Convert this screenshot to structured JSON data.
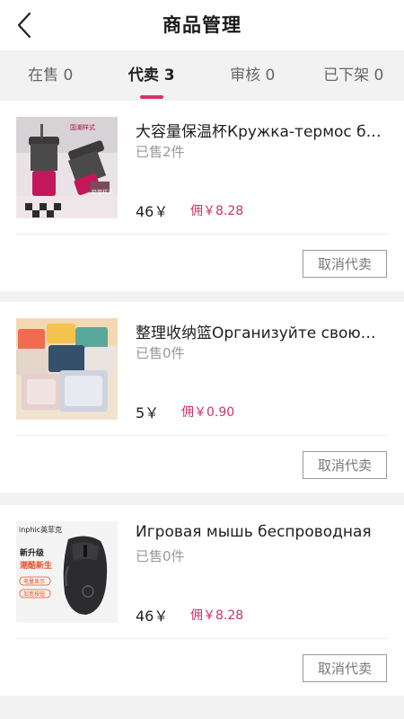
{
  "header": {
    "title": "商品管理"
  },
  "tabs": [
    {
      "label": "在售 0",
      "active": false
    },
    {
      "label": "代卖 3",
      "active": true
    },
    {
      "label": "审核 0",
      "active": false
    },
    {
      "label": "已下架 0",
      "active": false
    }
  ],
  "products": [
    {
      "title": "大容量保温杯Кружка-термос б…",
      "sold": "已售2件",
      "price": "46￥",
      "commission": "佣￥8.28",
      "action": "取消代卖",
      "thumb_icon": "tumbler-photo",
      "thumb_text": "国潮样式",
      "thumb_text2": "吸管样式"
    },
    {
      "title": "整理收纳篮Организуйте свою…",
      "sold": "已售0件",
      "price": "5￥",
      "commission": "佣￥0.90",
      "action": "取消代卖",
      "thumb_icon": "storage-baskets-photo"
    },
    {
      "title": "Игровая мышь беспроводная",
      "sold": "已售0件",
      "price": "46￥",
      "commission": "佣￥8.28",
      "action": "取消代卖",
      "thumb_icon": "gaming-mouse-photo",
      "thumb_brand": "inphic英菲克",
      "thumb_headline1": "新升级",
      "thumb_headline2": "潮酷新生",
      "thumb_tag1": "电量显示",
      "thumb_tag2": "加宽按钮"
    }
  ],
  "colors": {
    "accent": "#d6336c",
    "commission": "#c9336c"
  }
}
